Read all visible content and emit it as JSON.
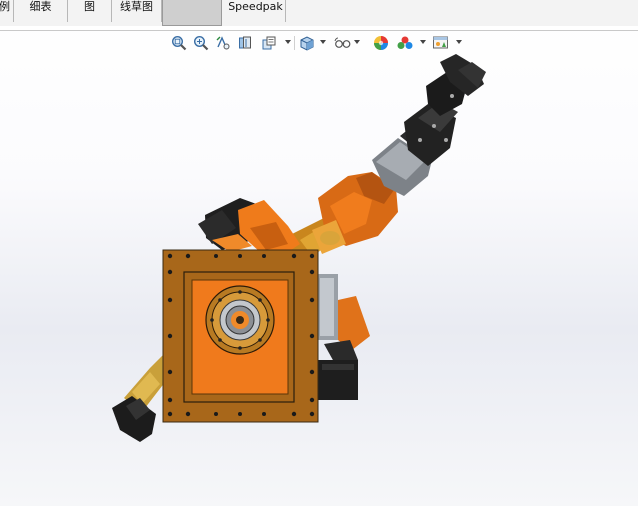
{
  "tabs": [
    {
      "label": "例"
    },
    {
      "label": "细表"
    },
    {
      "label": "图"
    },
    {
      "label": "线草图"
    },
    {
      "label": ""
    },
    {
      "label": "Speedpak"
    }
  ],
  "toolbar": {
    "items": [
      {
        "icon": "zoom-to-fit-icon"
      },
      {
        "icon": "zoom-to-area-icon"
      },
      {
        "icon": "previous-view-icon"
      },
      {
        "icon": "section-view-icon"
      },
      {
        "icon": "dynamic-annotation-view-icon"
      },
      {
        "icon": "view-orientation-icon"
      },
      {
        "icon": "display-style-icon"
      },
      {
        "icon": "hide-show-items-icon"
      },
      {
        "icon": "edit-appearance-icon"
      },
      {
        "icon": "apply-scene-icon"
      },
      {
        "icon": "view-settings-icon"
      }
    ]
  },
  "colors": {
    "model_orange": "#f07a1c",
    "model_brown": "#a9661a",
    "model_dark": "#262626",
    "model_gray": "#8a8f96",
    "model_gold": "#d4a03a"
  }
}
